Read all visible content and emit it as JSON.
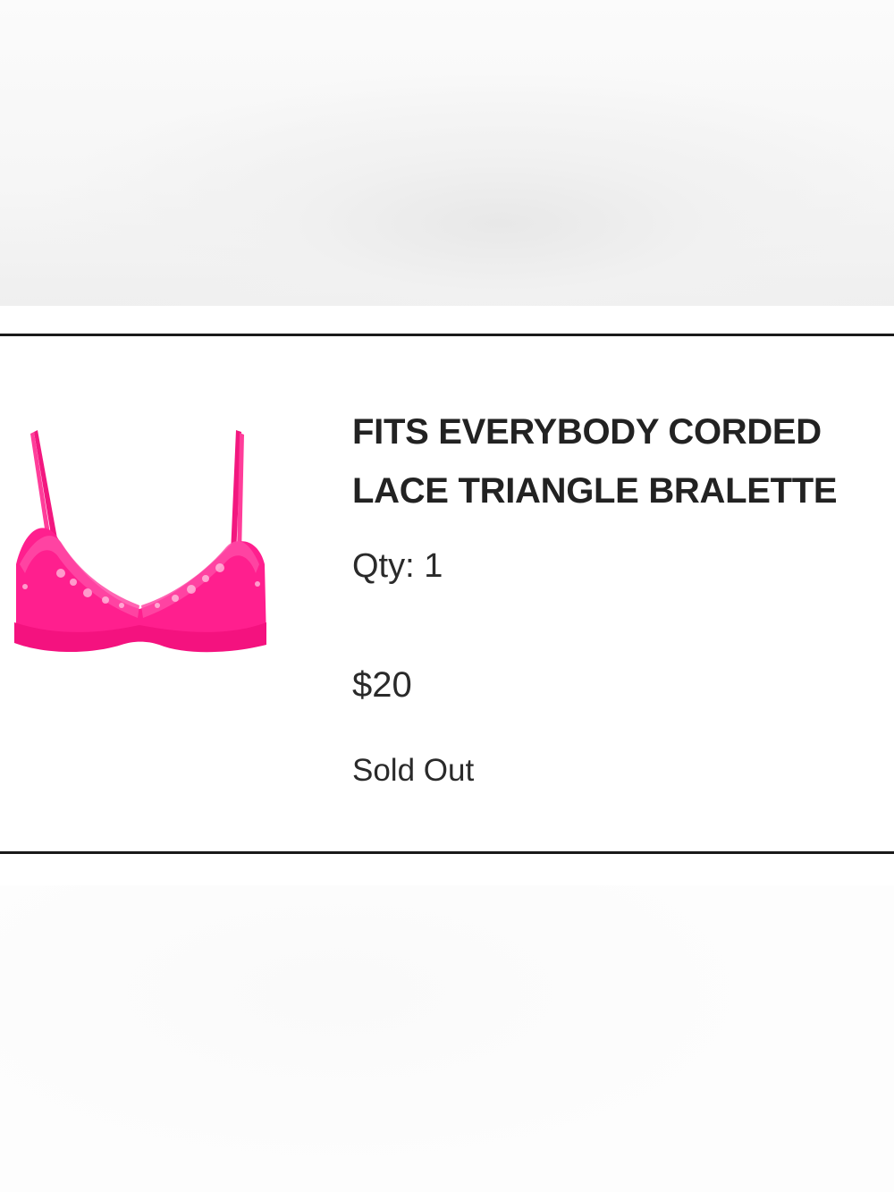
{
  "product": {
    "title_line1": "FITS EVERYBODY CORDED",
    "title_line2": "LACE TRIANGLE BRALETTE",
    "quantity": "Qty: 1",
    "price": "$20",
    "status": "Sold Out",
    "image_icon": "bralette-product-photo",
    "product_color": "#ff1f8e"
  }
}
